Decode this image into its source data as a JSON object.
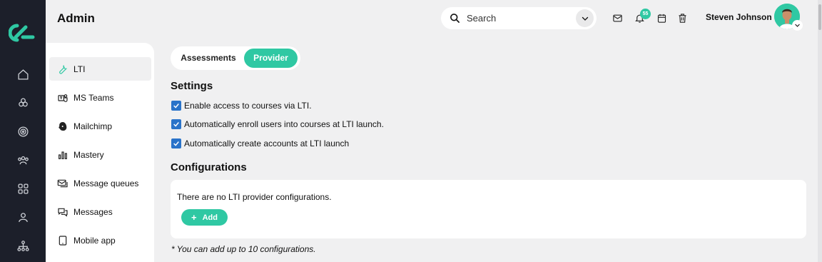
{
  "header": {
    "title": "Admin",
    "search_placeholder": "Search",
    "notification_count": "55",
    "user_name": "Steven Johnson"
  },
  "rail": {
    "icons": [
      "home-icon",
      "courses-icon",
      "target-icon",
      "users-group-icon",
      "apps-grid-icon",
      "user-icon",
      "org-chart-icon"
    ]
  },
  "sidebar": {
    "items": [
      {
        "label": "LTI",
        "icon": "wrench-icon",
        "active": true
      },
      {
        "label": "MS Teams",
        "icon": "ms-teams-icon"
      },
      {
        "label": "Mailchimp",
        "icon": "mailchimp-icon"
      },
      {
        "label": "Mastery",
        "icon": "bar-chart-icon"
      },
      {
        "label": "Message queues",
        "icon": "message-queue-icon"
      },
      {
        "label": "Messages",
        "icon": "chat-bubbles-icon"
      },
      {
        "label": "Mobile app",
        "icon": "tablet-icon"
      }
    ]
  },
  "tabs": [
    {
      "label": "Assessments",
      "active": false
    },
    {
      "label": "Provider",
      "active": true
    }
  ],
  "settings": {
    "title": "Settings",
    "options": [
      {
        "label": "Enable access to courses via LTI.",
        "checked": true
      },
      {
        "label": "Automatically enroll users into courses at LTI launch.",
        "checked": true
      },
      {
        "label": "Automatically create accounts at LTI launch",
        "checked": true
      }
    ]
  },
  "configurations": {
    "title": "Configurations",
    "empty_text": "There are no LTI provider configurations.",
    "add_label": "Add",
    "note": "* You can add up to 10 configurations."
  },
  "colors": {
    "accent": "#2fc8a3",
    "rail": "#1c1f2a",
    "checkbox": "#2a73c9",
    "background": "#f0f0f1"
  }
}
